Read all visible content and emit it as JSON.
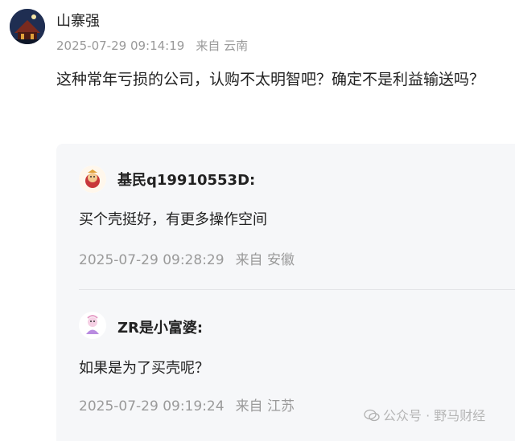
{
  "comment": {
    "username": "山寨强",
    "timestamp": "2025-07-29 09:14:19",
    "location": "来自 云南",
    "text": "这种常年亏损的公司，认购不太明智吧？确定不是利益输送吗？",
    "avatar_icon": "night-castle-avatar"
  },
  "replies": [
    {
      "username": "基民q19910553D:",
      "text": "买个壳挺好，有更多操作空间",
      "timestamp": "2025-07-29 09:28:29",
      "location": "来自 安徽",
      "avatar_icon": "fortune-bag-avatar"
    },
    {
      "username": "ZR是小富婆:",
      "text": "如果是为了买壳呢？",
      "timestamp": "2025-07-29 09:19:24",
      "location": "来自 江苏",
      "avatar_icon": "cartoon-figure-avatar"
    }
  ],
  "watermark": {
    "text": "公众号 · 野马财经",
    "icon": "wechat-icon"
  },
  "colors": {
    "reply_background": "#f6f7f9",
    "meta_text": "#9a9a9a",
    "primary_text": "#222222"
  }
}
